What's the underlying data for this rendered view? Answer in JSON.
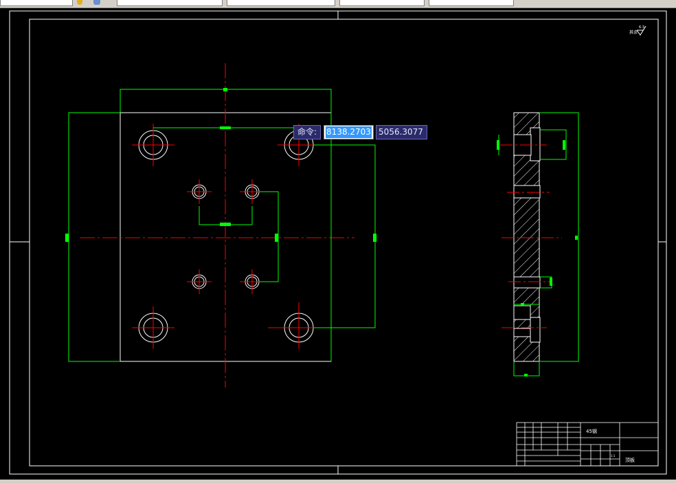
{
  "command": {
    "label": "命令:",
    "x_value": "8138.2703",
    "y_value": "5056.3077"
  },
  "title_block": {
    "material": "45钢",
    "part_name": "顶板",
    "roughness_note": "其余",
    "roughness_value": "6.3",
    "scale_hint": "1:1"
  },
  "colors": {
    "background": "#000000",
    "geometry": "#ffffff",
    "centerline": "#ff0000",
    "dimension": "#00ff00",
    "grip": "#00ff00",
    "prompt_bg": "#2b2b6a"
  },
  "icons": [
    "layer-icon",
    "render-icon"
  ]
}
